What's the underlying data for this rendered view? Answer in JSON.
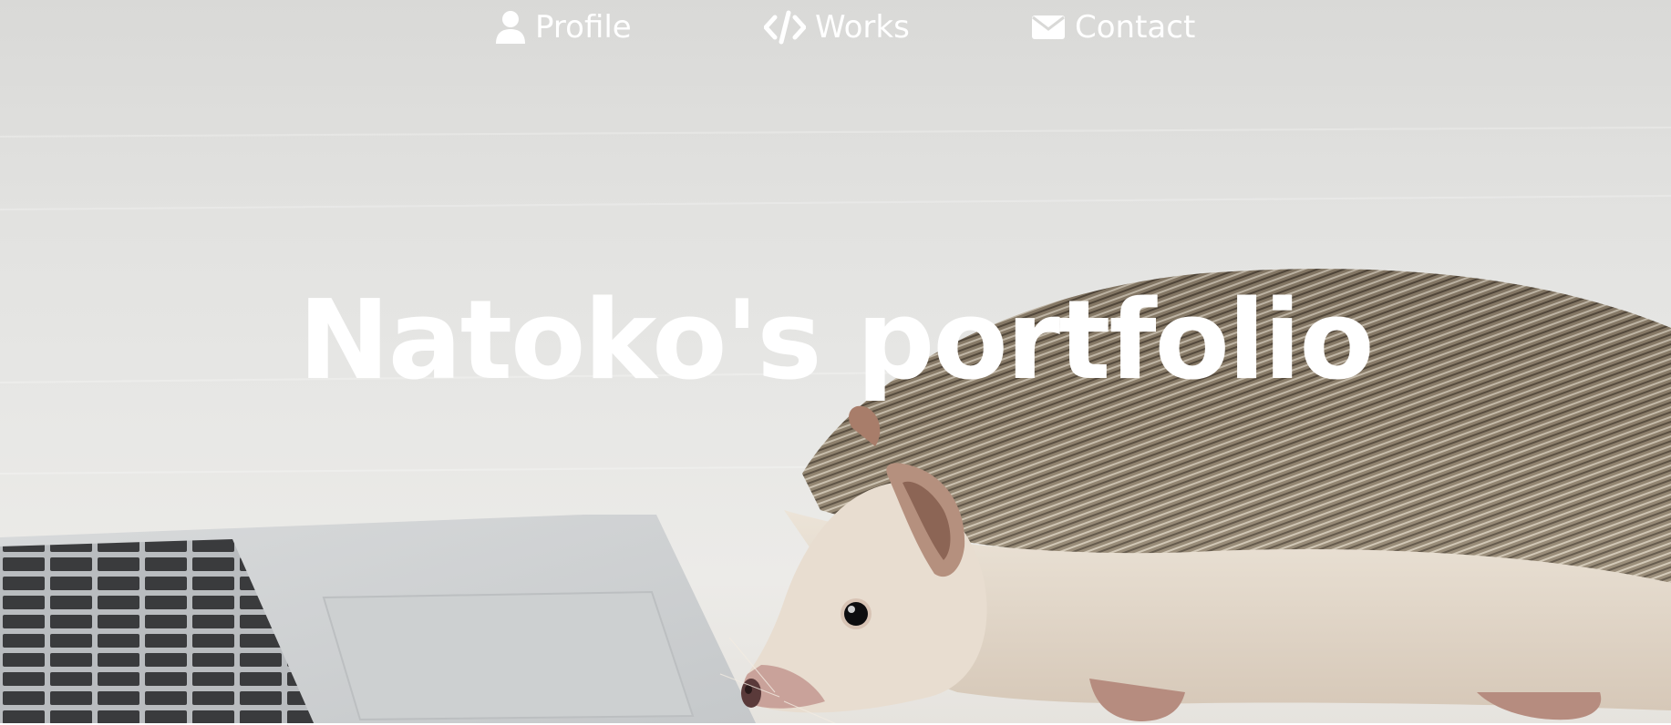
{
  "nav": {
    "items": [
      {
        "label": "Profile",
        "icon": "user-icon"
      },
      {
        "label": "Works",
        "icon": "code-icon"
      },
      {
        "label": "Contact",
        "icon": "envelope-icon"
      }
    ]
  },
  "hero": {
    "title": "Natoko's portfolio",
    "background_image": "hedgehog-beside-laptop-photo"
  },
  "colors": {
    "nav_text": "#ffffff",
    "title_text": "#ffffff",
    "background": "#e2e2e0"
  }
}
